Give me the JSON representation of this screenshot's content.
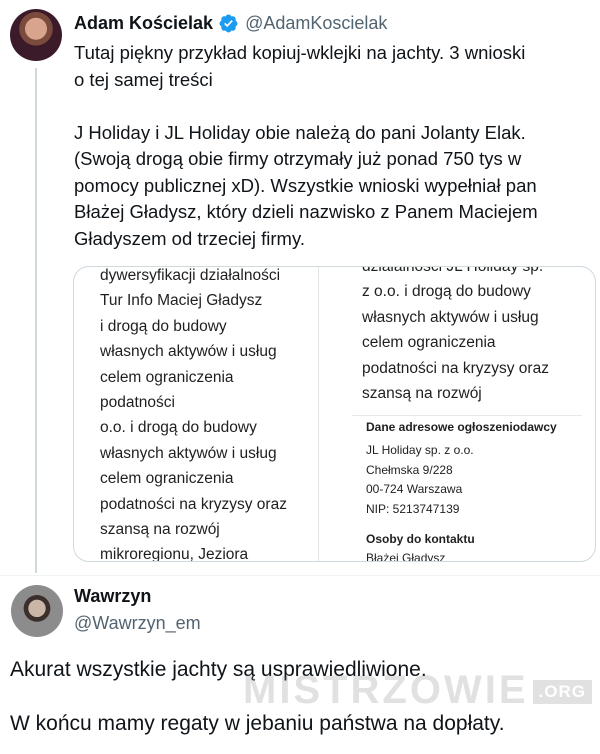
{
  "tweets": [
    {
      "author": {
        "name": "Adam Kościelak",
        "handle": "@AdamKoscielak",
        "verified": true,
        "verified_color": "#1d9bf0"
      },
      "text_lines": [
        "Tutaj piękny przykład kopiuj-wklejki na jachty. 3 wnioski",
        "o tej samej treści",
        "",
        "J Holiday i JL Holiday obie należą do pani Jolanty Elak.",
        "(Swoją drogą obie firmy otrzymały już ponad 750 tys w",
        "pomocy publicznej xD). Wszystkie wnioski wypełniał pan",
        "Błażej Gładysz, który dzieli nazwisko z Panem Maciejem",
        "Gładyszem od trzeciej firmy."
      ],
      "media": {
        "left_column_lines": [
          "dywersyfikacji działalności",
          "Tur Info Maciej Gładysz",
          "i drogą do budowy",
          "własnych aktywów i usług",
          "celem ograniczenia",
          "podatności",
          "o.o. i drogą do budowy",
          "własnych aktywów i usług",
          "celem ograniczenia",
          "podatności na kryzysy oraz",
          "szansą na rozwój",
          "mikroregionu, Jeziora"
        ],
        "right_column_lines": [
          "działalności JL Holiday sp.",
          "z o.o. i drogą do budowy",
          "własnych aktywów i usług",
          "celem ograniczenia",
          "podatności na kryzysy oraz",
          "szansą na rozwój"
        ],
        "address_section": {
          "title": "Dane adresowe ogłoszeniodawcy",
          "lines": [
            "JL Holiday sp. z o.o.",
            "Chełmska 9/228",
            "00-724 Warszawa",
            "NIP: 5213747139"
          ],
          "contact_title": "Osoby do kontaktu",
          "contact_name": "Błażej Gładysz"
        }
      }
    },
    {
      "author": {
        "name": "Wawrzyn",
        "handle": "@Wawrzyn_em"
      },
      "text_lines": [
        "Akurat wszystkie jachty są usprawiedliwione.",
        "",
        "W końcu mamy regaty w jebaniu państwa na dopłaty."
      ]
    }
  ],
  "watermark": {
    "text": "MISTRZOWIE",
    "suffix": ".ORG"
  }
}
